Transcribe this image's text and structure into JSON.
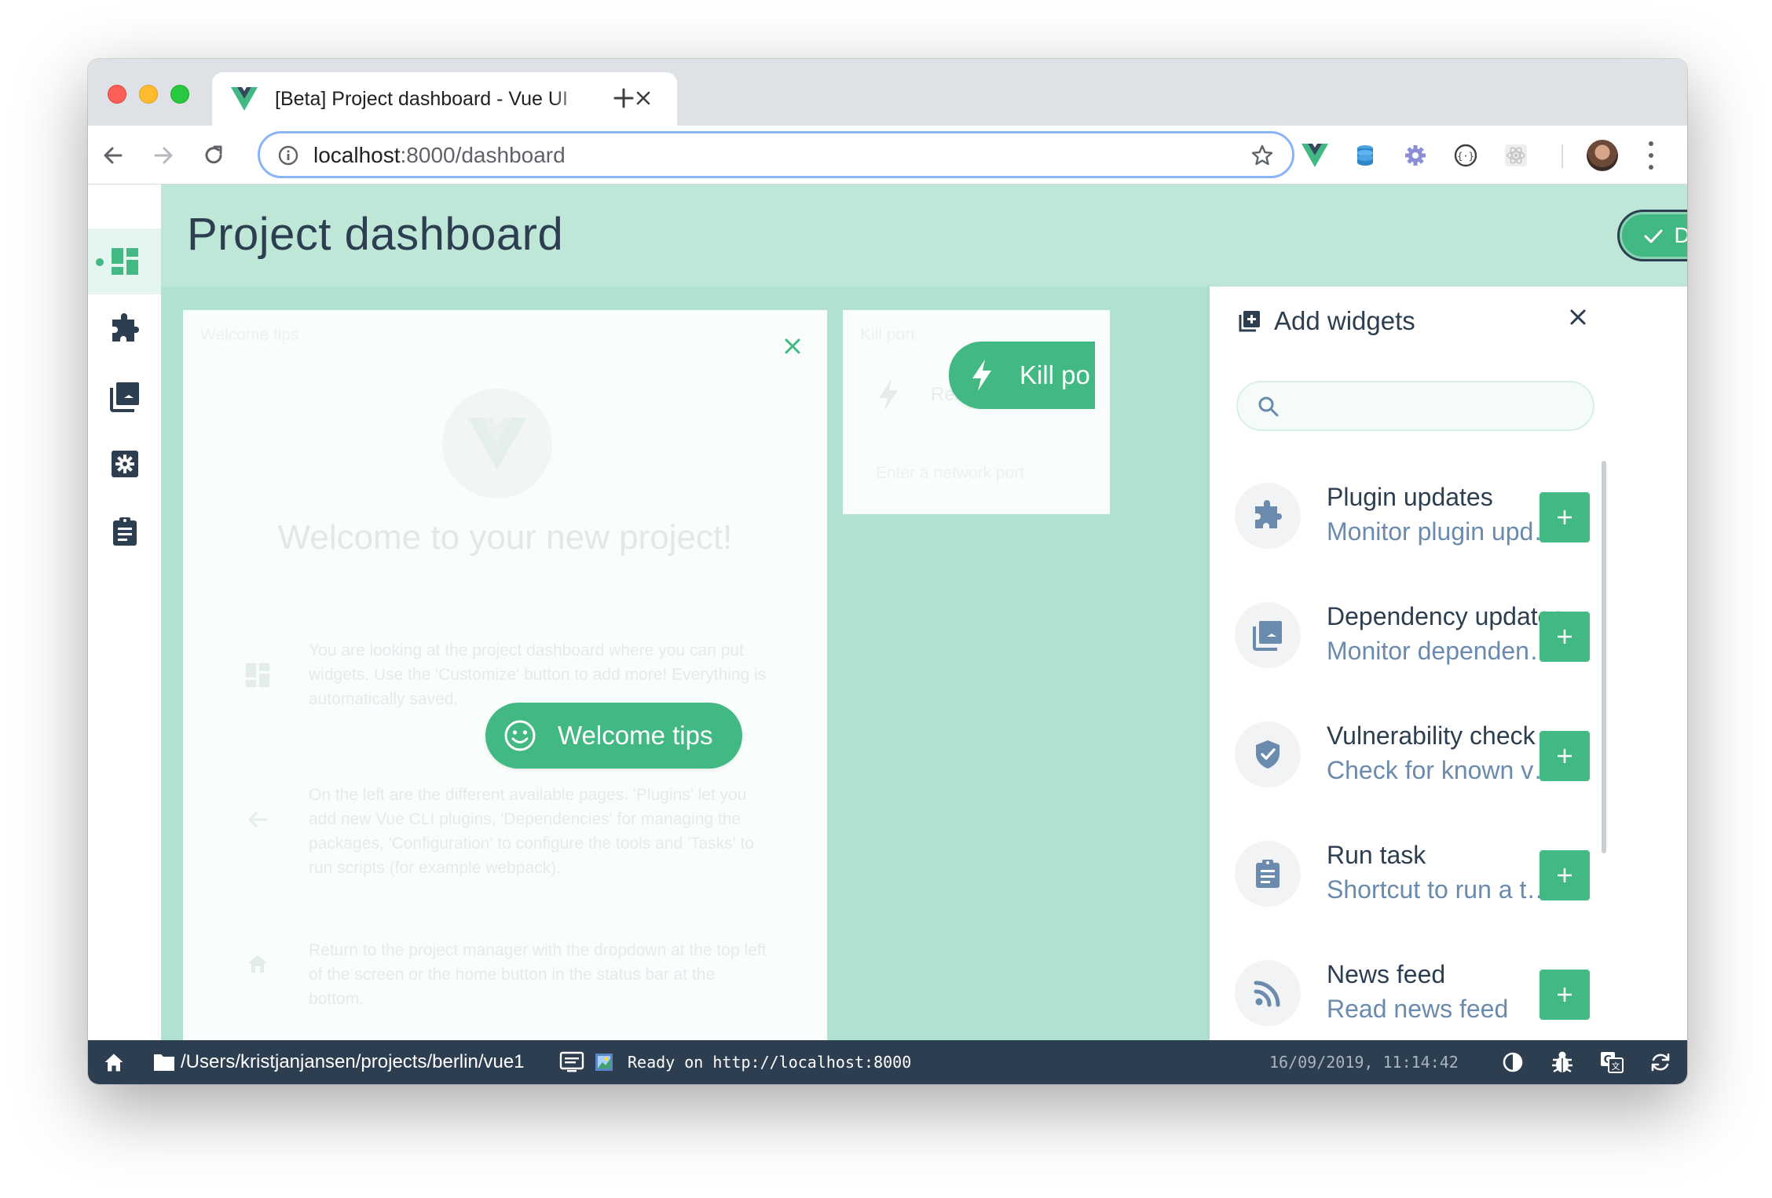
{
  "browser": {
    "tab_title": "[Beta] Project dashboard - Vue UI",
    "url_host": "localhost",
    "url_rest": ":8000/dashboard"
  },
  "app": {
    "page_title": "Project dashboard",
    "done_label": "Done",
    "sidebar": [
      "dashboard-icon",
      "plugins-icon",
      "dependencies-icon",
      "configuration-icon",
      "tasks-icon"
    ]
  },
  "widgets": {
    "welcome": {
      "title": "Welcome tips",
      "heading": "Welcome to your new project!",
      "tip1": "You are looking at the project dashboard where you can put widgets. Use the 'Customize' button to add more! Everything is automatically saved.",
      "tip2": "On the left are the different available pages. 'Plugins' let you add new Vue CLI plugins, 'Dependencies' for managing the packages, 'Configuration' to configure the tools and 'Tasks' to run scripts (for example webpack).",
      "tip3": "Return to the project manager with the dropdown at the top left of the screen or the home button in the status bar at the bottom.",
      "drag_label": "Welcome tips"
    },
    "kill_port": {
      "title": "Kill port",
      "status": "Rea",
      "input_placeholder": "Enter a network port",
      "drag_label": "Kill po"
    }
  },
  "panel": {
    "title": "Add widgets",
    "search_placeholder": "",
    "items": [
      {
        "name": "Plugin updates",
        "description": "Monitor plugin updates",
        "icon": "puzzle-icon"
      },
      {
        "name": "Dependency updates",
        "description": "Monitor dependencies updates",
        "icon": "library-icon"
      },
      {
        "name": "Vulnerability check",
        "description": "Check for known vulnerabilities",
        "icon": "shield-icon"
      },
      {
        "name": "Run task",
        "description": "Shortcut to run a task",
        "icon": "clipboard-icon"
      },
      {
        "name": "News feed",
        "description": "Read news feed",
        "icon": "rss-icon"
      }
    ]
  },
  "statusbar": {
    "path": "/Users/kristjanjansen/projects/berlin/vue1",
    "log": "Ready on http://localhost:8000",
    "datetime": "16/09/2019, 11:14:42"
  },
  "colors": {
    "accent": "#42b983",
    "dark": "#2c3e50",
    "board_bg": "#b1e2cf"
  }
}
